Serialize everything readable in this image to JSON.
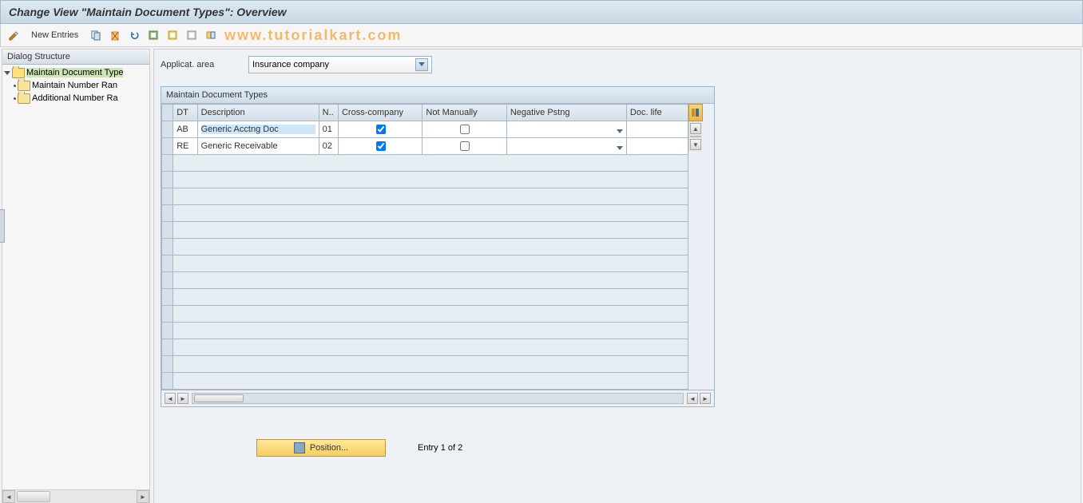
{
  "title": "Change View \"Maintain Document Types\": Overview",
  "watermark": "www.tutorialkart.com",
  "toolbar": {
    "new_entries": "New Entries"
  },
  "sidebar": {
    "header": "Dialog Structure",
    "items": [
      {
        "label": "Maintain Document Type",
        "open": true,
        "selected": true,
        "level": 0
      },
      {
        "label": "Maintain Number Ran",
        "open": false,
        "selected": false,
        "level": 1
      },
      {
        "label": "Additional Number Ra",
        "open": false,
        "selected": false,
        "level": 1
      }
    ]
  },
  "applicat": {
    "label": "Applicat. area",
    "value": "Insurance company"
  },
  "grid": {
    "title": "Maintain Document Types",
    "columns": [
      "DT",
      "Description",
      "N..",
      "Cross-company",
      "Not Manually",
      "Negative Pstng",
      "Doc. life"
    ],
    "rows": [
      {
        "dt": "AB",
        "desc": "Generic Acctng Doc",
        "n": "01",
        "cross": true,
        "notman": false,
        "neg": "",
        "life": ""
      },
      {
        "dt": "RE",
        "desc": "Generic Receivable",
        "n": "02",
        "cross": true,
        "notman": false,
        "neg": "",
        "life": ""
      }
    ],
    "empty_rows": 14
  },
  "footer": {
    "position_btn": "Position...",
    "entry_text": "Entry 1 of 2"
  }
}
